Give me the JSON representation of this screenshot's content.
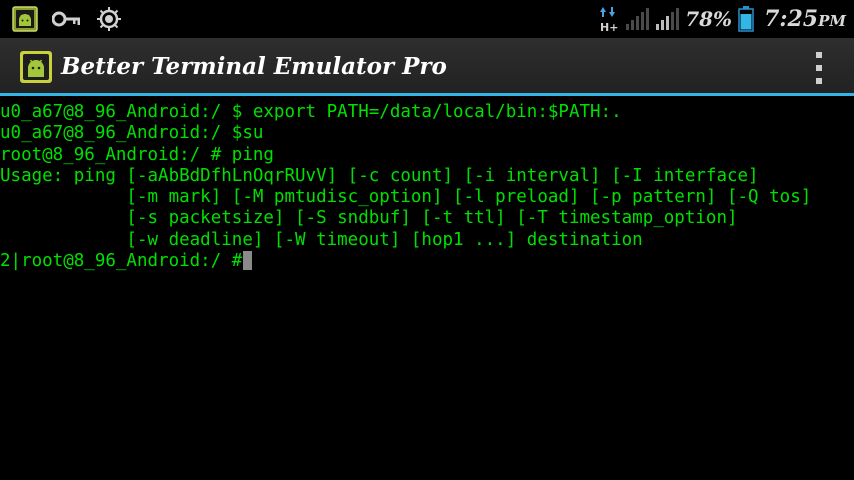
{
  "status_bar": {
    "icons_left": [
      "android-notification-icon",
      "key-icon",
      "usb-debug-icon"
    ],
    "icons_right": [
      "data-hplus-icon",
      "signal-strength-icon",
      "signal-strength-icon",
      "battery-icon"
    ],
    "network_type": "H+",
    "battery_percent": "78%",
    "time": "7:25",
    "time_suffix": "PM"
  },
  "action_bar": {
    "title": "Better Terminal Emulator Pro",
    "app_icon": "android-terminal-icon",
    "menu_icon": "overflow-menu-icon",
    "accent_color": "#33b5e5"
  },
  "terminal": {
    "text_color": "#00e000",
    "background": "#000000",
    "lines": [
      "u0_a67@8_96_Android:/ $ export PATH=/data/local/bin:$PATH:.",
      "u0_a67@8_96_Android:/ $su",
      "root@8_96_Android:/ # ping",
      "Usage: ping [-aAbBdDfhLnOqrRUvV] [-c count] [-i interval] [-I interface]",
      "            [-m mark] [-M pmtudisc_option] [-l preload] [-p pattern] [-Q tos]",
      "            [-s packetsize] [-S sndbuf] [-t ttl] [-T timestamp_option]",
      "            [-w deadline] [-W timeout] [hop1 ...] destination"
    ],
    "prompt": "2|root@8_96_Android:/ #"
  }
}
